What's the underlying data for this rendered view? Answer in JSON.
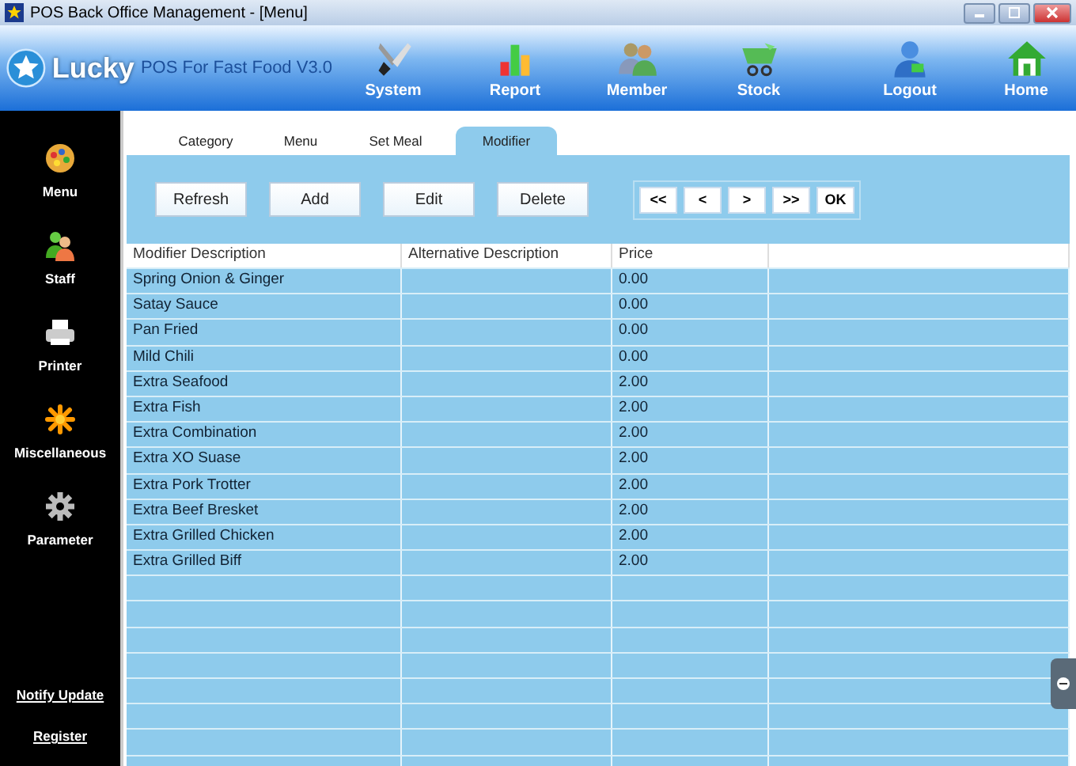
{
  "window": {
    "title": "POS Back Office Management - [Menu]"
  },
  "brand": {
    "name": "Lucky",
    "subtitle": "POS For Fast Food V3.0"
  },
  "toolbar": [
    {
      "kind": "system",
      "label": "System"
    },
    {
      "kind": "report",
      "label": "Report"
    },
    {
      "kind": "member",
      "label": "Member"
    },
    {
      "kind": "stock",
      "label": "Stock"
    },
    {
      "kind": "logout",
      "label": "Logout"
    },
    {
      "kind": "home",
      "label": "Home"
    }
  ],
  "sidebar": {
    "items": [
      {
        "kind": "menu",
        "label": "Menu"
      },
      {
        "kind": "staff",
        "label": "Staff"
      },
      {
        "kind": "printer",
        "label": "Printer"
      },
      {
        "kind": "misc",
        "label": "Miscellaneous"
      },
      {
        "kind": "parameter",
        "label": "Parameter"
      }
    ],
    "links": [
      "Notify Update",
      "Register"
    ]
  },
  "tabs": [
    {
      "label": "Category",
      "selected": false
    },
    {
      "label": "Menu",
      "selected": false
    },
    {
      "label": "Set Meal",
      "selected": false
    },
    {
      "label": "Modifier",
      "selected": true
    }
  ],
  "buttons": [
    "Refresh",
    "Add",
    "Edit",
    "Delete"
  ],
  "pager": [
    "<<",
    "<",
    ">",
    ">>",
    "OK"
  ],
  "table": {
    "columns": [
      "Modifier Description",
      "Alternative Description",
      "Price"
    ],
    "rows": [
      [
        "Spring Onion & Ginger",
        "",
        "0.00"
      ],
      [
        "Satay Sauce",
        "",
        "0.00"
      ],
      [
        "Pan Fried",
        "",
        "0.00"
      ],
      [
        "Mild Chili",
        "",
        "0.00"
      ],
      [
        "Extra Seafood",
        "",
        "2.00"
      ],
      [
        "Extra Fish",
        "",
        "2.00"
      ],
      [
        "Extra Combination",
        "",
        "2.00"
      ],
      [
        "Extra XO Suase",
        "",
        "2.00"
      ],
      [
        "Extra Pork Trotter",
        "",
        "2.00"
      ],
      [
        "Extra Beef Bresket",
        "",
        "2.00"
      ],
      [
        "Extra Grilled Chicken",
        "",
        "2.00"
      ],
      [
        "Extra Grilled Biff",
        "",
        "2.00"
      ]
    ]
  }
}
